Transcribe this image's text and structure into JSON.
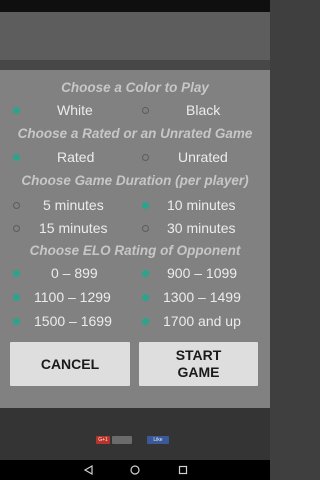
{
  "dialog": {
    "color_title": "Choose a Color to Play",
    "color_options": [
      {
        "label": "White",
        "selected": true
      },
      {
        "label": "Black",
        "selected": false
      }
    ],
    "rated_title": "Choose a Rated or an Unrated Game",
    "rated_options": [
      {
        "label": "Rated",
        "selected": true
      },
      {
        "label": "Unrated",
        "selected": false
      }
    ],
    "duration_title": "Choose Game Duration (per player)",
    "duration_options": [
      {
        "label": "5 minutes",
        "selected": false
      },
      {
        "label": "10 minutes",
        "selected": true
      },
      {
        "label": "15 minutes",
        "selected": false
      },
      {
        "label": "30 minutes",
        "selected": false
      }
    ],
    "elo_title": "Choose ELO Rating of Opponent",
    "elo_options": [
      {
        "label": "0 – 899",
        "selected": true
      },
      {
        "label": "900 – 1099",
        "selected": true
      },
      {
        "label": "1100 – 1299",
        "selected": true
      },
      {
        "label": "1300 – 1499",
        "selected": true
      },
      {
        "label": "1500 – 1699",
        "selected": true
      },
      {
        "label": "1700 and up",
        "selected": true
      }
    ],
    "cancel_label": "CANCEL",
    "start_label": "START GAME"
  },
  "ads": {
    "left_button": "G+1",
    "right_button": "Like"
  },
  "colors": {
    "accent": "#2aa58c",
    "dialog_bg": "#818181",
    "title_text": "#c7c7c7",
    "button_bg": "#dedede"
  }
}
